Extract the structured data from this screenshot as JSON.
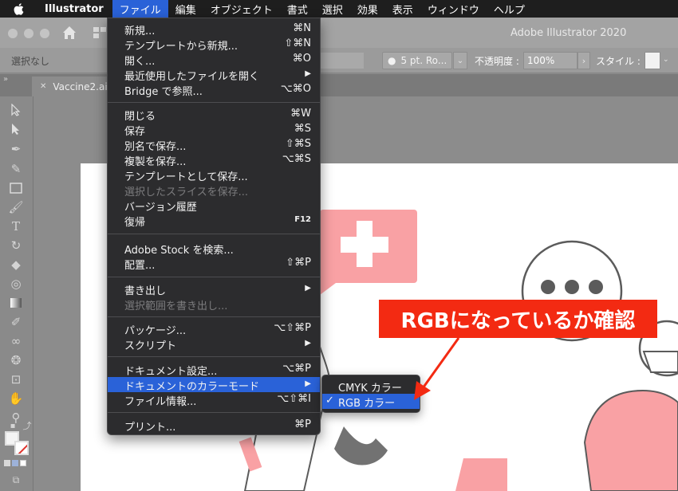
{
  "menubar": {
    "app_name": "Illustrator",
    "items": [
      "ファイル",
      "編集",
      "オブジェクト",
      "書式",
      "選択",
      "効果",
      "表示",
      "ウィンドウ",
      "ヘルプ"
    ],
    "active_index": 0
  },
  "window": {
    "title": "Adobe Illustrator 2020"
  },
  "control_bar": {
    "selection": "選択なし",
    "brush": "5 pt. Ro...",
    "opacity_label": "不透明度 :",
    "opacity_value": "100%",
    "style_label": "スタイル :"
  },
  "document_tab": {
    "name": "Vaccine2.ai*"
  },
  "file_menu": {
    "items": [
      {
        "label": "新規...",
        "shortcut": "⌘N"
      },
      {
        "label": "テンプレートから新規...",
        "shortcut": "⇧⌘N"
      },
      {
        "label": "開く...",
        "shortcut": "⌘O"
      },
      {
        "label": "最近使用したファイルを開く",
        "shortcut": "▶"
      },
      {
        "label": "Bridge で参照...",
        "shortcut": "⌥⌘O"
      },
      {
        "label": "閉じる",
        "shortcut": "⌘W"
      },
      {
        "label": "保存",
        "shortcut": "⌘S"
      },
      {
        "label": "別名で保存...",
        "shortcut": "⇧⌘S"
      },
      {
        "label": "複製を保存...",
        "shortcut": "⌥⌘S"
      },
      {
        "label": "テンプレートとして保存...",
        "shortcut": ""
      },
      {
        "label": "選択したスライスを保存...",
        "shortcut": ""
      },
      {
        "label": "バージョン履歴",
        "shortcut": ""
      },
      {
        "label": "復帰",
        "shortcut": "F12"
      },
      {
        "label": "Adobe Stock を検索...",
        "shortcut": ""
      },
      {
        "label": "配置...",
        "shortcut": "⇧⌘P"
      },
      {
        "label": "書き出し",
        "shortcut": "▶"
      },
      {
        "label": "選択範囲を書き出し...",
        "shortcut": ""
      },
      {
        "label": "パッケージ...",
        "shortcut": "⌥⇧⌘P"
      },
      {
        "label": "スクリプト",
        "shortcut": "▶"
      },
      {
        "label": "ドキュメント設定...",
        "shortcut": "⌥⌘P"
      },
      {
        "label": "ドキュメントのカラーモード",
        "shortcut": "▶"
      },
      {
        "label": "ファイル情報...",
        "shortcut": "⌥⇧⌘I"
      },
      {
        "label": "プリント...",
        "shortcut": "⌘P"
      }
    ]
  },
  "color_mode_submenu": {
    "items": [
      {
        "label": "CMYK カラー",
        "checked": false
      },
      {
        "label": "RGB カラー",
        "checked": true,
        "check_mark": "✓"
      }
    ]
  },
  "annotation": {
    "text": "RGBになっているか確認",
    "color": "#f32a12"
  },
  "colors": {
    "menu_highlight": "#2a62d8",
    "menu_bg": "#2c2c2e",
    "artwork_pink": "#f9a1a4"
  }
}
